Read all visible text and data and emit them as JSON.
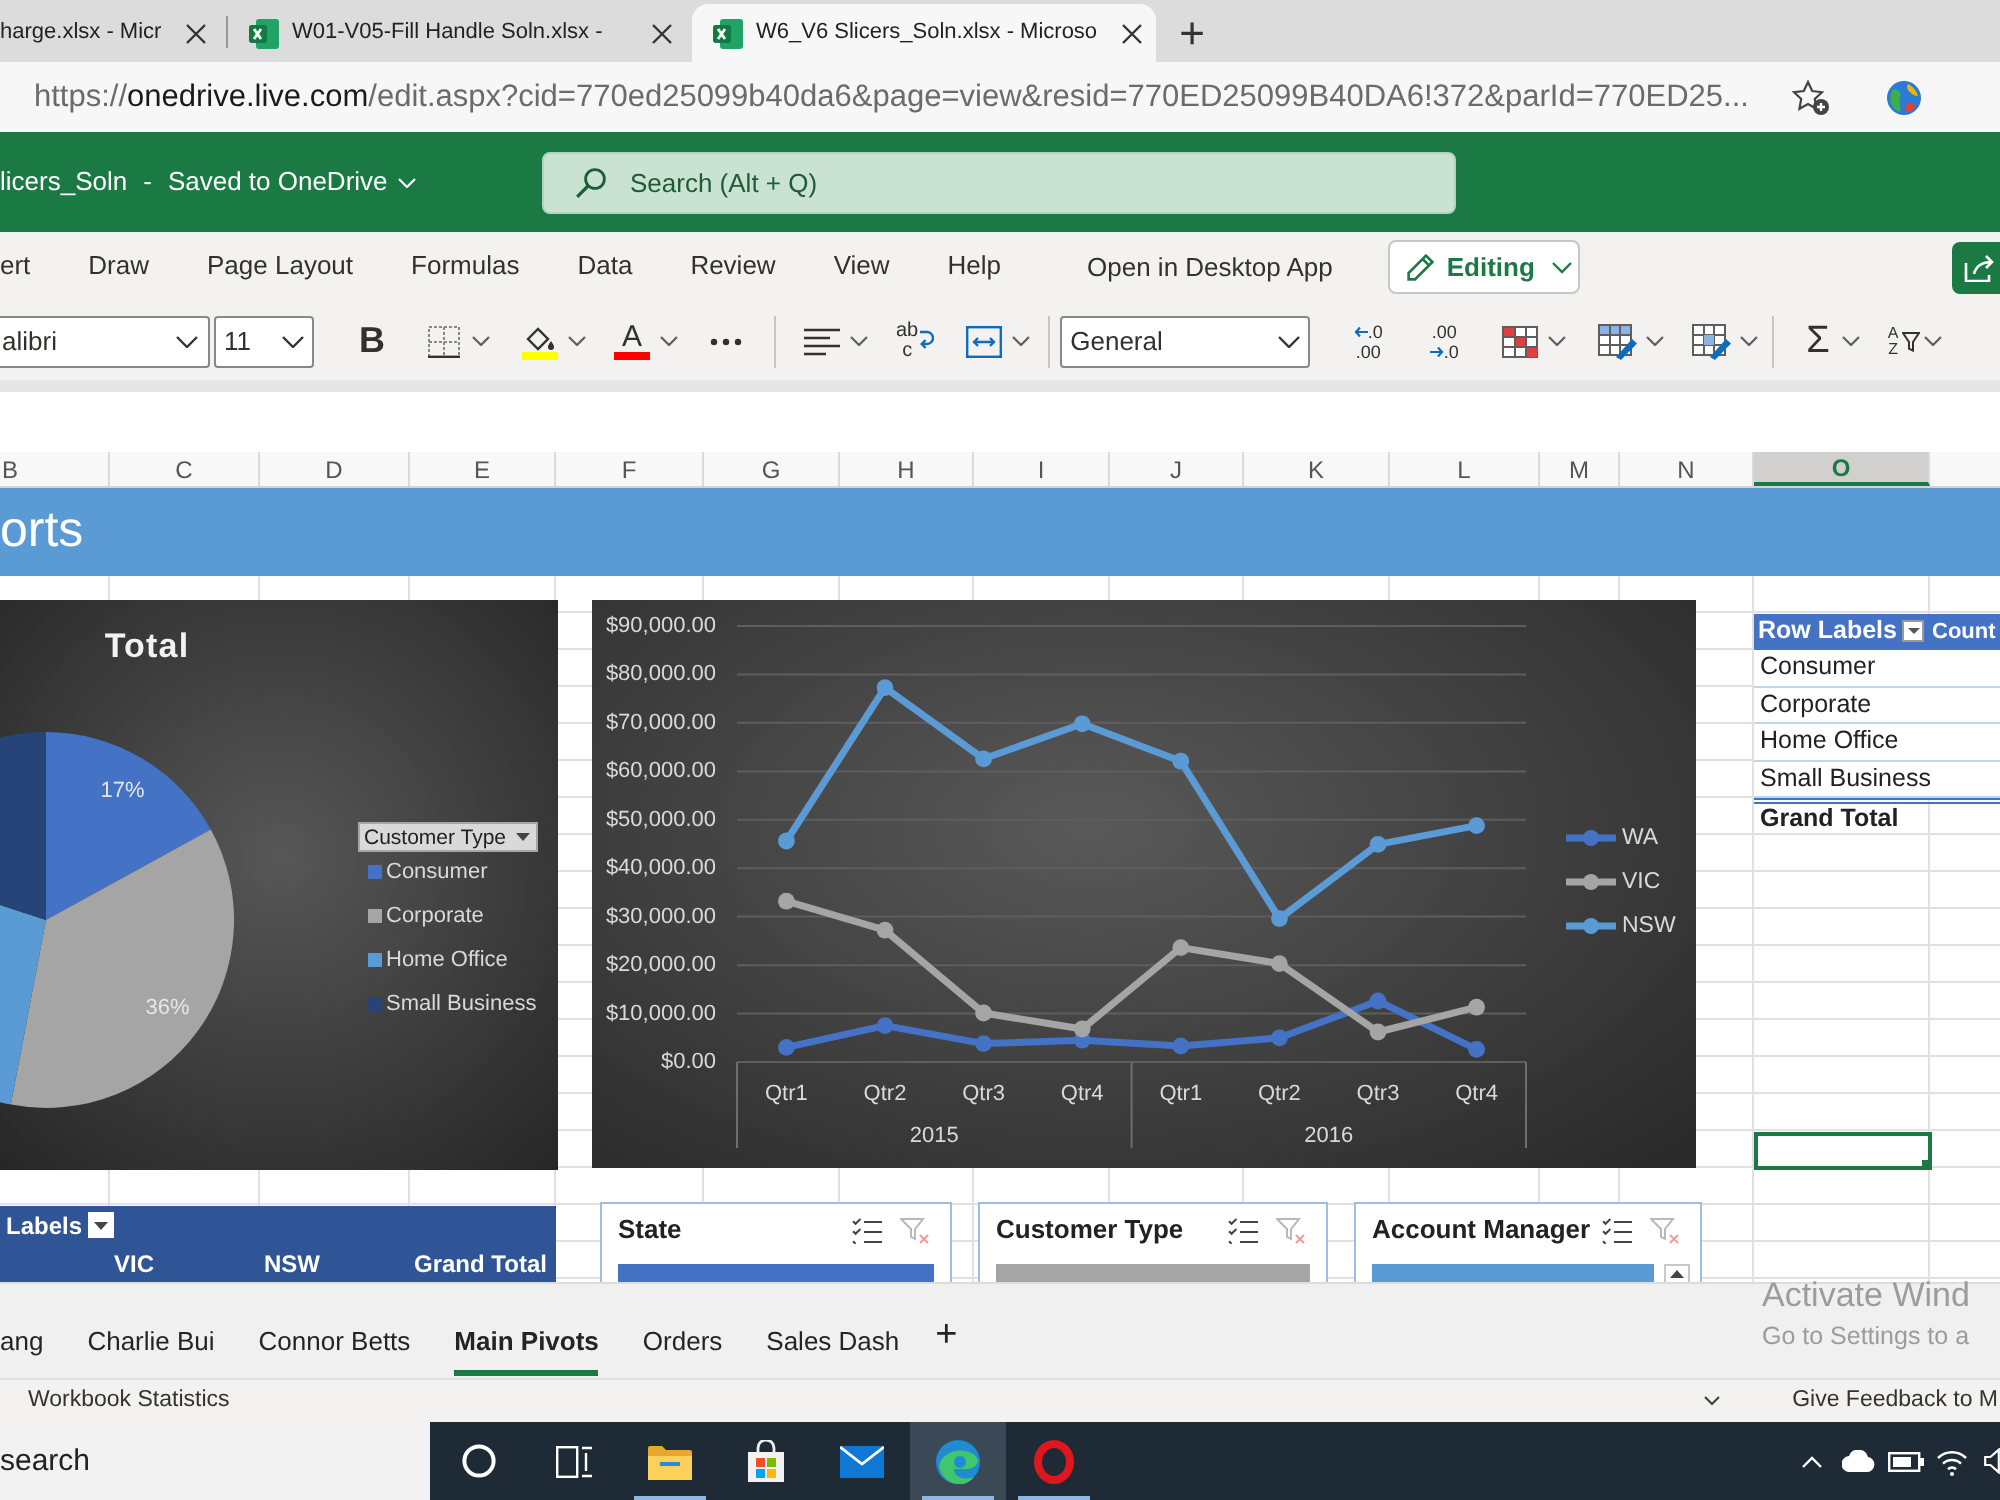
{
  "browser": {
    "tabs": [
      {
        "title": "harge.xlsx - Micr",
        "icon": false,
        "selected": false
      },
      {
        "title": "W01-V05-Fill Handle Soln.xlsx -",
        "icon": true,
        "selected": false
      },
      {
        "title": "W6_V6 Slicers_Soln.xlsx - Microso",
        "icon": true,
        "selected": true
      }
    ],
    "new_tab": "+",
    "address": {
      "scheme": "https://",
      "host": "onedrive.live.com",
      "path": "/edit.aspx?cid=770ed25099b40da6&page=view&resid=770ED25099B40DA6!372&parId=770ED25..."
    }
  },
  "app_header": {
    "file_name": "licers_Soln",
    "separator": "-",
    "save_status": "Saved to OneDrive",
    "search": {
      "placeholder": "Search (Alt + Q)"
    }
  },
  "ribbon": {
    "tabs": [
      {
        "label": "ert",
        "selected": false
      },
      {
        "label": "Draw",
        "selected": false
      },
      {
        "label": "Page Layout",
        "selected": false
      },
      {
        "label": "Formulas",
        "selected": false
      },
      {
        "label": "Data",
        "selected": false
      },
      {
        "label": "Review",
        "selected": false
      },
      {
        "label": "View",
        "selected": false
      },
      {
        "label": "Help",
        "selected": false
      }
    ],
    "open_in_desktop": "Open in Desktop App",
    "mode": "Editing"
  },
  "toolbar": {
    "font": "alibri",
    "font_size": "11",
    "bold": "B",
    "font_color": "A",
    "wrap_text": [
      "ab",
      "c"
    ],
    "number_format": "General",
    "increase_decimal": [
      ".0",
      ".00"
    ],
    "decrease_decimal": [
      ".00",
      ".0"
    ],
    "autosum": "Σ",
    "sort": [
      "A",
      "Z"
    ]
  },
  "sheet": {
    "columns": [
      {
        "letter": "B",
        "selected": false
      },
      {
        "letter": "C",
        "selected": false
      },
      {
        "letter": "D",
        "selected": false
      },
      {
        "letter": "E",
        "selected": false
      },
      {
        "letter": "F",
        "selected": false
      },
      {
        "letter": "G",
        "selected": false
      },
      {
        "letter": "H",
        "selected": false
      },
      {
        "letter": "I",
        "selected": false
      },
      {
        "letter": "J",
        "selected": false
      },
      {
        "letter": "K",
        "selected": false
      },
      {
        "letter": "L",
        "selected": false
      },
      {
        "letter": "M",
        "selected": false
      },
      {
        "letter": "N",
        "selected": false
      },
      {
        "letter": "O",
        "selected": true
      }
    ],
    "banner": "orts"
  },
  "pie_chart": {
    "chart_data": {
      "type": "pie",
      "title": "Total",
      "categories": [
        "Consumer",
        "Corporate",
        "Home Office",
        "Small Business"
      ],
      "colors": [
        "#4472c4",
        "#a5a5a5",
        "#5b9bd5",
        "#264478"
      ],
      "values": [
        17,
        36,
        27,
        20
      ],
      "value_labels": [
        "17%",
        "36%",
        null,
        null
      ],
      "legend": "right"
    },
    "legend_filter": "Customer Type"
  },
  "line_chart": {
    "chart_data": {
      "type": "line",
      "categories": [
        "Qtr1",
        "Qtr2",
        "Qtr3",
        "Qtr4",
        "Qtr1",
        "Qtr2",
        "Qtr3",
        "Qtr4"
      ],
      "series": [
        {
          "name": "WA",
          "color": "#4472c4",
          "marker": "circle",
          "values": [
            3000,
            7500,
            3800,
            4500,
            3300,
            5000,
            12600,
            2600
          ]
        },
        {
          "name": "VIC",
          "color": "#a5a5a5",
          "marker": "circle",
          "values": [
            33200,
            27200,
            10100,
            6800,
            23600,
            20300,
            6200,
            11300
          ]
        },
        {
          "name": "NSW",
          "color": "#5b9bd5",
          "marker": "circle",
          "values": [
            45600,
            77300,
            62600,
            69800,
            62100,
            29600,
            44900,
            48800
          ]
        }
      ],
      "ylim": [
        0,
        90000
      ],
      "yticks": [
        {
          "value": 0,
          "label": "$0.00"
        },
        {
          "value": 10000,
          "label": "$10,000.00"
        },
        {
          "value": 20000,
          "label": "$20,000.00"
        },
        {
          "value": 30000,
          "label": "$30,000.00"
        },
        {
          "value": 40000,
          "label": "$40,000.00"
        },
        {
          "value": 50000,
          "label": "$50,000.00"
        },
        {
          "value": 60000,
          "label": "$60,000.00"
        },
        {
          "value": 70000,
          "label": "$70,000.00"
        },
        {
          "value": 80000,
          "label": "$80,000.00"
        },
        {
          "value": 90000,
          "label": "$90,000.00"
        }
      ],
      "grid": "y",
      "legend": "right",
      "annotations": [
        "2015",
        "2016"
      ]
    }
  },
  "pivot_table": {
    "headers": [
      "Row Labels",
      "Count"
    ],
    "rows": [
      "Consumer",
      "Corporate",
      "Home Office",
      "Small Business"
    ],
    "total": "Grand Total"
  },
  "region_pivot": {
    "header": "Labels",
    "columns": [
      "VIC",
      "NSW",
      "Grand Total"
    ]
  },
  "slicers": [
    {
      "title": "State",
      "color": "#4472c4",
      "scrollable": false
    },
    {
      "title": "Customer Type",
      "color": "#a5a5a5",
      "scrollable": false
    },
    {
      "title": "Account Manager",
      "color": "#5b9bd5",
      "scrollable": true
    }
  ],
  "sheet_tabs": {
    "tabs": [
      {
        "label": "ang",
        "selected": false
      },
      {
        "label": "Charlie Bui",
        "selected": false
      },
      {
        "label": "Connor Betts",
        "selected": false
      },
      {
        "label": "Main Pivots",
        "selected": true
      },
      {
        "label": "Orders",
        "selected": false
      },
      {
        "label": "Sales Dash",
        "selected": false
      }
    ],
    "add": "+"
  },
  "status_bar": {
    "left": "Workbook Statistics",
    "right": "Give Feedback to M"
  },
  "activation_notice": {
    "title": "Activate Wind",
    "subtitle": "Go to Settings to a"
  },
  "taskbar": {
    "search": {
      "placeholder": "search"
    },
    "apps": [
      {
        "kind": "files",
        "running": true,
        "selected": false
      },
      {
        "kind": "store",
        "running": false,
        "selected": false
      },
      {
        "kind": "mail",
        "running": false,
        "selected": false
      },
      {
        "kind": "edge",
        "running": true,
        "selected": true
      },
      {
        "kind": "opera",
        "running": true,
        "selected": false
      }
    ]
  }
}
